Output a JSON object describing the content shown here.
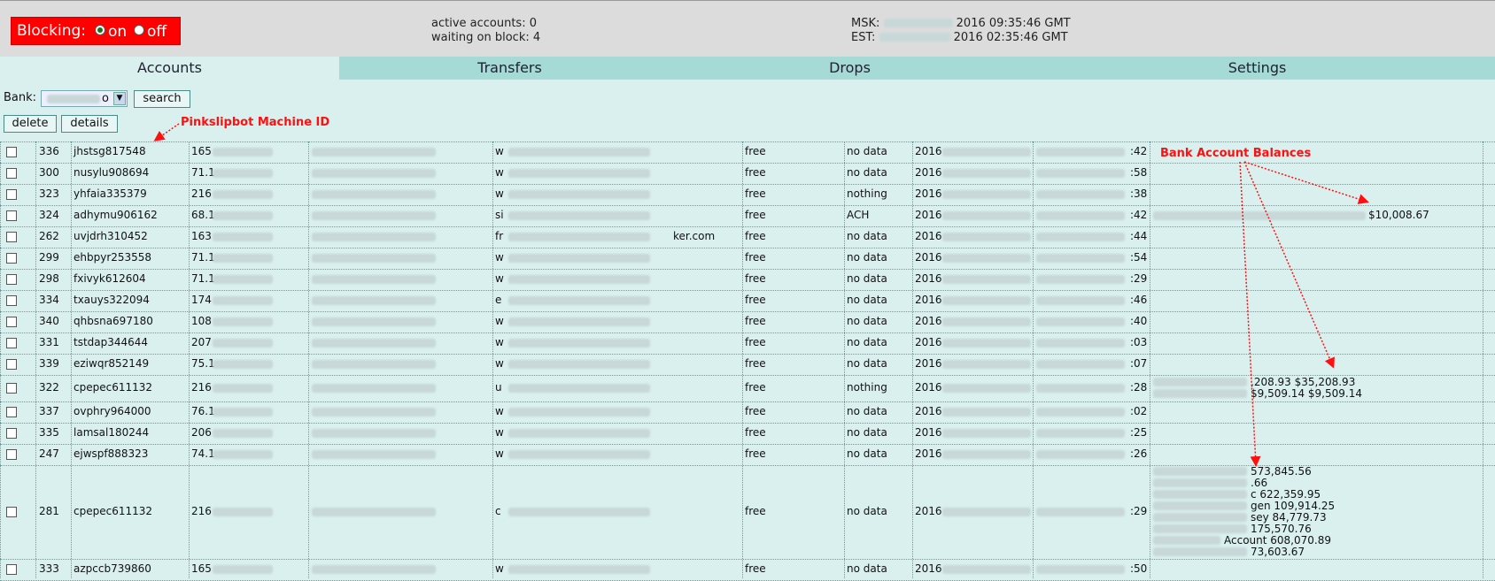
{
  "blocking": {
    "label": "Blocking:",
    "on_label": "on",
    "off_label": "off",
    "selected": "on"
  },
  "stats": {
    "active_accounts": "active accounts: 0",
    "waiting_on_block": "waiting on block: 4"
  },
  "clock": {
    "msk_label": "MSK:",
    "msk_value": "2016 09:35:46 GMT",
    "est_label": "EST:",
    "est_value": "2016 02:35:46 GMT"
  },
  "tabs": [
    "Accounts",
    "Transfers",
    "Drops",
    "Settings"
  ],
  "toolbar": {
    "bank_label": "Bank:",
    "bank_value": "o",
    "search_label": "search",
    "delete_label": "delete",
    "details_label": "details"
  },
  "annotations": {
    "machine_id": "Pinkslipbot Machine ID",
    "balances": "Bank Account Balances"
  },
  "colors": {
    "blocking_bg": "#ff0000",
    "tab_bar": "#a6dad6",
    "page_bg": "#d9f0ef",
    "annotation": "#ff1010"
  },
  "rows": [
    {
      "id": "336",
      "machine": "jhstsg817548",
      "ip": "165",
      "site": "w",
      "status": "free",
      "type": "no data",
      "date": "2016",
      "tail": ":42",
      "balances": []
    },
    {
      "id": "300",
      "machine": "nusylu908694",
      "ip": "71.1",
      "site": "w",
      "status": "free",
      "type": "no data",
      "date": "2016",
      "tail": ":58",
      "balances": []
    },
    {
      "id": "323",
      "machine": "yhfaia335379",
      "ip": "216",
      "site": "w",
      "status": "free",
      "type": "nothing",
      "date": "2016",
      "tail": ":38",
      "balances": []
    },
    {
      "id": "324",
      "machine": "adhymu906162",
      "ip": "68.1",
      "site": "si",
      "status": "free",
      "type": "ACH",
      "date": "2016",
      "tail": ":42",
      "balances": [
        "$10,008.67"
      ]
    },
    {
      "id": "262",
      "machine": "uvjdrh310452",
      "ip": "163",
      "site": "fr",
      "site_tail": "ker.com",
      "status": "free",
      "type": "no data",
      "date": "2016",
      "tail": ":44",
      "balances": []
    },
    {
      "id": "299",
      "machine": "ehbpyr253558",
      "ip": "71.1",
      "site": "w",
      "status": "free",
      "type": "no data",
      "date": "2016",
      "tail": ":54",
      "balances": []
    },
    {
      "id": "298",
      "machine": "fxivyk612604",
      "ip": "71.1",
      "site": "w",
      "status": "free",
      "type": "no data",
      "date": "2016",
      "tail": ":29",
      "balances": []
    },
    {
      "id": "334",
      "machine": "txauys322094",
      "ip": "174",
      "site": "e",
      "status": "free",
      "type": "no data",
      "date": "2016",
      "tail": ":46",
      "balances": []
    },
    {
      "id": "340",
      "machine": "qhbsna697180",
      "ip": "108",
      "site": "w",
      "status": "free",
      "type": "no data",
      "date": "2016",
      "tail": ":40",
      "balances": []
    },
    {
      "id": "331",
      "machine": "tstdap344644",
      "ip": "207",
      "site": "w",
      "status": "free",
      "type": "no data",
      "date": "2016",
      "tail": ":03",
      "balances": []
    },
    {
      "id": "339",
      "machine": "eziwqr852149",
      "ip": "75.1",
      "site": "w",
      "status": "free",
      "type": "no data",
      "date": "2016",
      "tail": ":07",
      "balances": []
    },
    {
      "id": "322",
      "machine": "cpepec611132",
      "ip": "216",
      "site": "u",
      "status": "free",
      "type": "nothing",
      "date": "2016",
      "tail": ":28",
      "balances": [
        ",208.93 $35,208.93",
        "$9,509.14 $9,509.14"
      ]
    },
    {
      "id": "337",
      "machine": "ovphry964000",
      "ip": "76.1",
      "site": "w",
      "status": "free",
      "type": "no data",
      "date": "2016",
      "tail": ":02",
      "balances": []
    },
    {
      "id": "335",
      "machine": "lamsal180244",
      "ip": "206",
      "site": "w",
      "status": "free",
      "type": "no data",
      "date": "2016",
      "tail": ":25",
      "balances": []
    },
    {
      "id": "247",
      "machine": "ejwspf888323",
      "ip": "74.1",
      "site": "w",
      "status": "free",
      "type": "no data",
      "date": "2016",
      "tail": ":26",
      "balances": []
    },
    {
      "id": "281",
      "machine": "cpepec611132",
      "ip": "216",
      "site": "c",
      "status": "free",
      "type": "no data",
      "date": "2016",
      "tail": ":29",
      "balances": [
        "573,845.56",
        ".66",
        "c 622,359.95",
        "gen 109,914.25",
        "sey 84,779.73",
        "175,570.76",
        "Account 608,070.89",
        "73,603.67"
      ]
    },
    {
      "id": "333",
      "machine": "azpccb739860",
      "ip": "165",
      "site": "w",
      "status": "free",
      "type": "no data",
      "date": "2016",
      "tail": ":50",
      "balances": []
    }
  ]
}
